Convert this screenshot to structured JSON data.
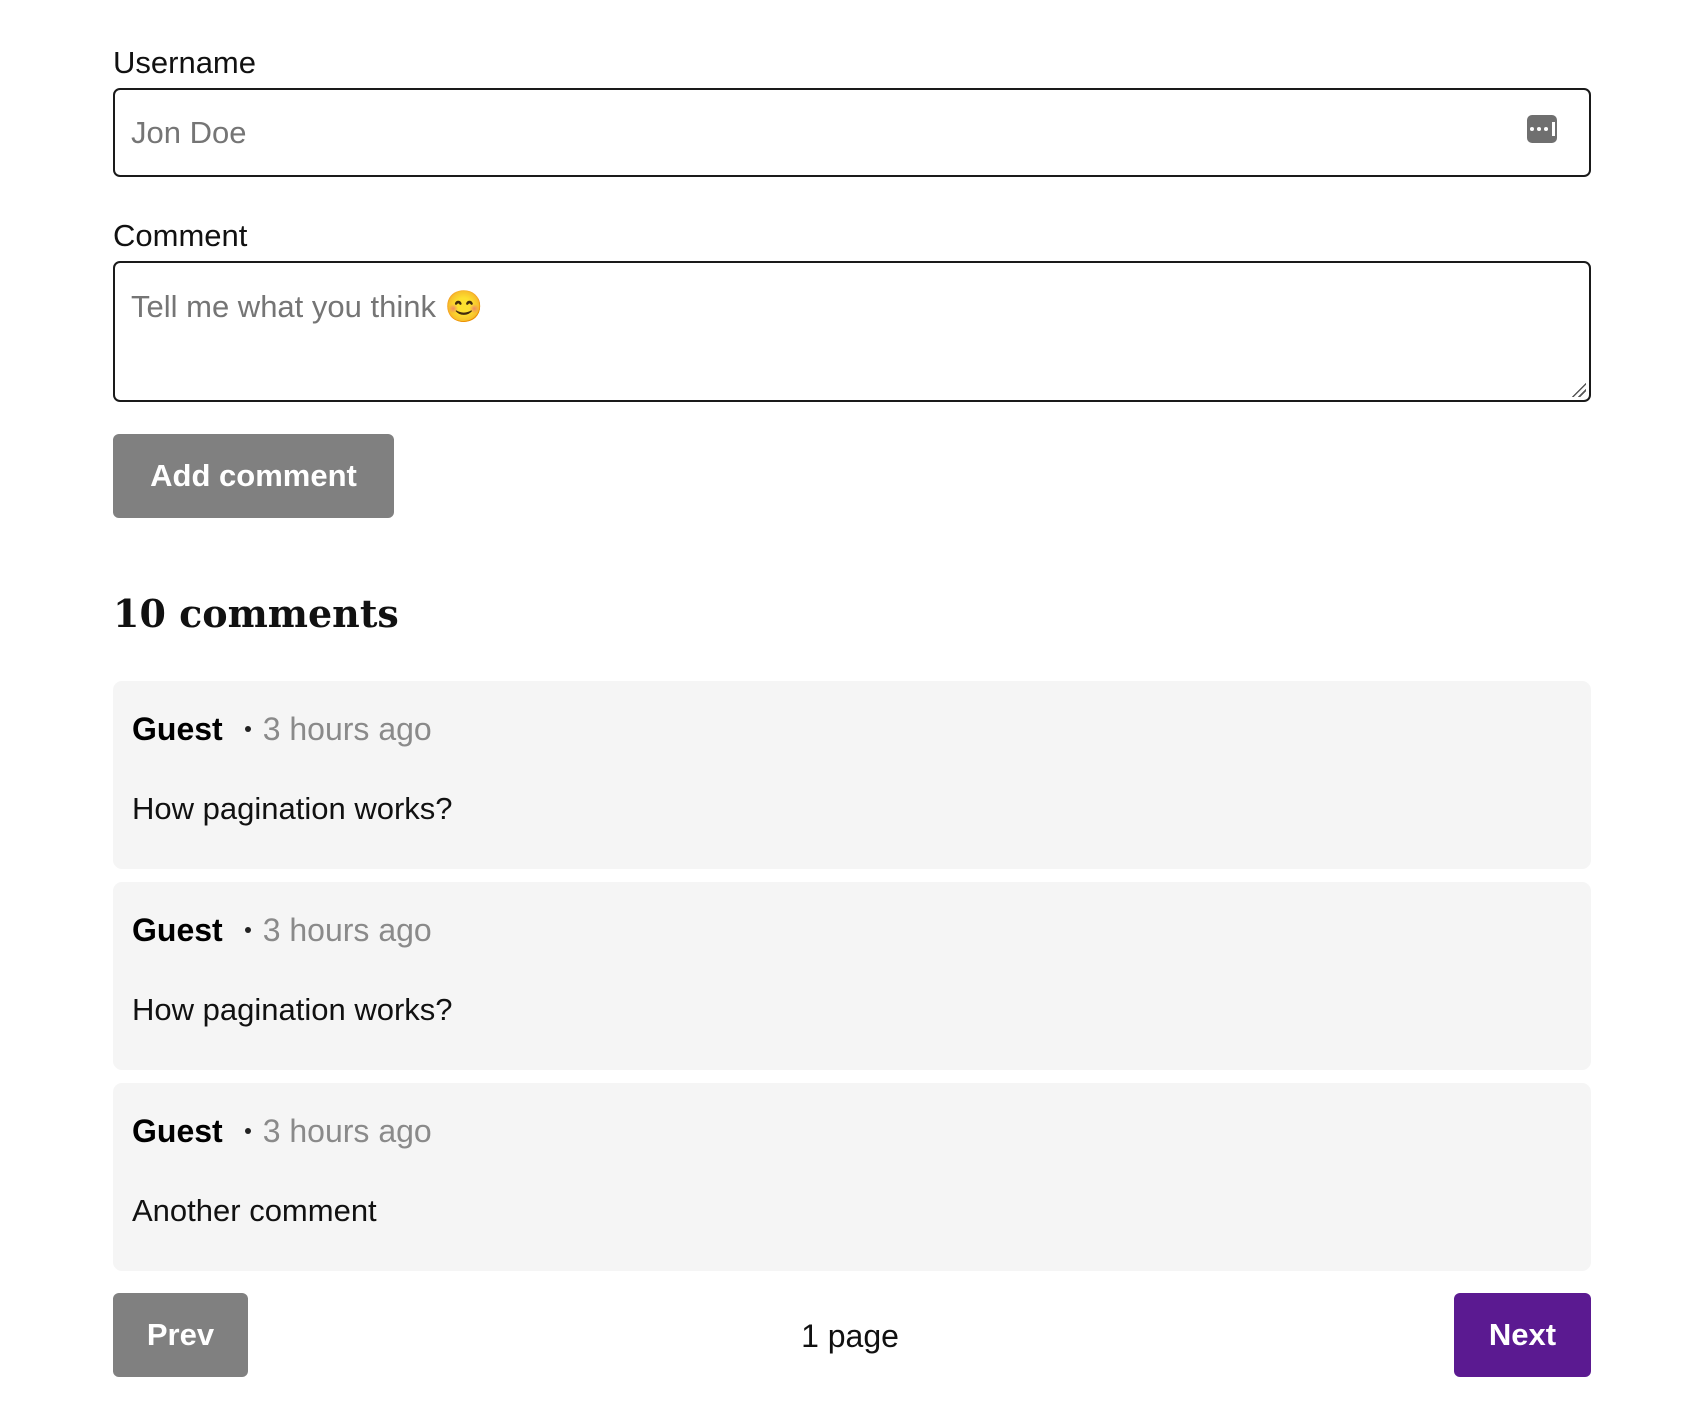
{
  "form": {
    "username_label": "Username",
    "username_placeholder": "Jon Doe",
    "username_value": "",
    "autofill_icon": "password-autofill-icon",
    "comment_label": "Comment",
    "comment_placeholder": "Tell me what you think 😊",
    "comment_value": "",
    "submit_label": "Add comment"
  },
  "comments_section": {
    "heading": "10 comments",
    "items": [
      {
        "author": "Guest",
        "time": "3 hours ago",
        "body": "How pagination works?"
      },
      {
        "author": "Guest",
        "time": "3 hours ago",
        "body": "How pagination works?"
      },
      {
        "author": "Guest",
        "time": "3 hours ago",
        "body": "Another comment"
      }
    ]
  },
  "pagination": {
    "prev_label": "Prev",
    "page_label": "1 page",
    "next_label": "Next"
  },
  "colors": {
    "disabled_button": "#808080",
    "primary_button": "#5b1a91",
    "card_background": "#f5f5f5",
    "muted_text": "#8a8a8a"
  }
}
